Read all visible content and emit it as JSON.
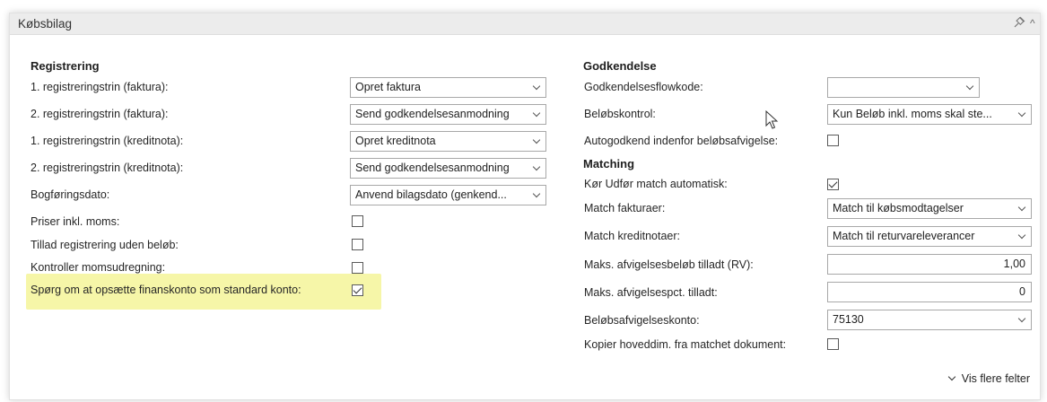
{
  "panel": {
    "title": "Købsbilag",
    "pin_icon": "pin-icon",
    "collapse_icon": "caret-up-icon",
    "collapse_glyph": "^"
  },
  "registrering": {
    "title": "Registrering",
    "rows": [
      {
        "label": "1. registreringstrin (faktura):",
        "value": "Opret faktura"
      },
      {
        "label": "2. registreringstrin (faktura):",
        "value": "Send godkendelsesanmodning"
      },
      {
        "label": "1. registreringstrin (kreditnota):",
        "value": "Opret kreditnota"
      },
      {
        "label": "2. registreringstrin (kreditnota):",
        "value": "Send godkendelsesanmodning"
      },
      {
        "label": "Bogføringsdato:",
        "value": "Anvend bilagsdato (genkend..."
      }
    ],
    "checks": [
      {
        "label": "Priser inkl. moms:",
        "checked": false
      },
      {
        "label": "Tillad registrering uden beløb:",
        "checked": false
      },
      {
        "label": "Kontroller momsudregning:",
        "checked": false
      },
      {
        "label": "Spørg om at opsætte finanskonto som standard konto:",
        "checked": true
      }
    ]
  },
  "godkendelse": {
    "title": "Godkendelse",
    "flowkode_label": "Godkendelsesflowkode:",
    "flowkode_value": "",
    "beloeb_label": "Beløbskontrol:",
    "beloeb_value": "Kun Beløb inkl. moms skal ste...",
    "autogodkend_label": "Autogodkend indenfor beløbsafvigelse:",
    "autogodkend_checked": false
  },
  "matching": {
    "title": "Matching",
    "koer_label": "Kør Udfør match automatisk:",
    "koer_checked": true,
    "fakturaer_label": "Match fakturaer:",
    "fakturaer_value": "Match til købsmodtagelser",
    "kreditnotaer_label": "Match kreditnotaer:",
    "kreditnotaer_value": "Match til returvareleverancer",
    "maks_beloeb_label": "Maks. afvigelsesbeløb tilladt (RV):",
    "maks_beloeb_value": "1,00",
    "maks_pct_label": "Maks. afvigelsespct. tilladt:",
    "maks_pct_value": "0",
    "konto_label": "Beløbsafvigelseskonto:",
    "konto_value": "75130",
    "kopier_label": "Kopier hoveddim. fra matchet dokument:",
    "kopier_checked": false
  },
  "footer": {
    "show_more": "Vis flere felter"
  },
  "colors": {
    "highlight": "#f6f6a8",
    "header_bg": "#ececec"
  }
}
